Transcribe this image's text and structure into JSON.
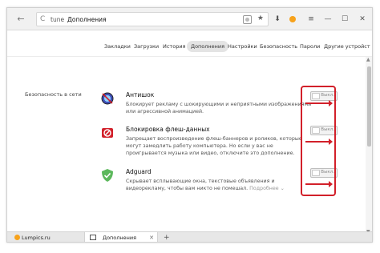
{
  "address_bar": {
    "host": "tune",
    "page": "Дополнения"
  },
  "toolbar": {
    "back_glyph": "←",
    "reload_glyph": "C",
    "star_glyph": "★",
    "download_glyph": "⬇",
    "menu_glyph": "≡",
    "minimize_glyph": "—",
    "maximize_glyph": "☐",
    "close_glyph": "✕"
  },
  "settings_tabs": [
    {
      "label": "Закладки"
    },
    {
      "label": "Загрузки"
    },
    {
      "label": "История"
    },
    {
      "label": "Дополнения",
      "active": true
    },
    {
      "label": "Настройки"
    },
    {
      "label": "Безопасность"
    },
    {
      "label": "Пароли"
    },
    {
      "label": "Другие устройст"
    }
  ],
  "section": {
    "label": "Безопасность в сети"
  },
  "extensions": [
    {
      "name": "Антишок",
      "description": "Блокирует рекламу с шокирующими и неприятными изображениями или агрессивной анимацией.",
      "toggle_label": "Выкл.",
      "enabled": false,
      "icon": "antishock-icon"
    },
    {
      "name": "Блокировка флеш-данных",
      "description": "Запрещает воспроизведение флеш-баннеров и роликов, которые могут замедлить работу компьютера. Но если у вас не проигрывается музыка или видео, отключите это дополнение.",
      "toggle_label": "Выкл.",
      "enabled": false,
      "icon": "flash-block-icon"
    },
    {
      "name": "Adguard",
      "description": "Скрывает всплывающие окна, текстовые объявления и видеорекламу, чтобы вам никто не помешал.",
      "more_label": "Подробнее",
      "toggle_label": "Выкл.",
      "enabled": false,
      "icon": "adguard-icon"
    }
  ],
  "bottom_tabs": [
    {
      "label": "Lumpics.ru",
      "favicon_color": "#f7a21b"
    },
    {
      "label": "Дополнения",
      "active": true,
      "close_glyph": "✕"
    }
  ],
  "new_tab_glyph": "+",
  "colors": {
    "highlight": "#d2202a",
    "yandex_dot": "#f7a21b"
  }
}
